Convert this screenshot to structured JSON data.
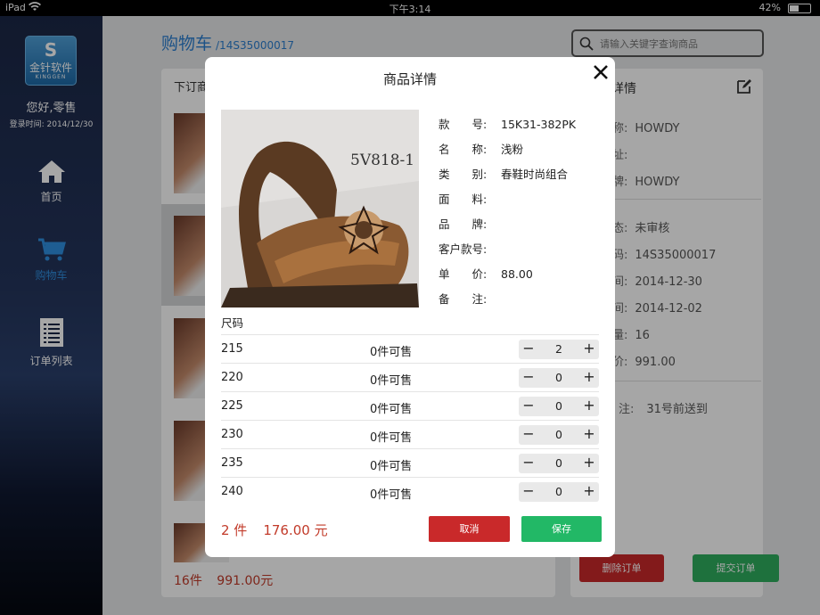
{
  "status_bar": {
    "device": "iPad",
    "time": "下午3:14",
    "battery": "42%"
  },
  "sidebar": {
    "logo": {
      "mark": "S",
      "cn": "金针软件",
      "en": "KINGGEN"
    },
    "greeting": "您好,零售",
    "login_time": "登录时间: 2014/12/30",
    "items": [
      {
        "label": "首页",
        "icon": "home-icon"
      },
      {
        "label": "购物车",
        "icon": "cart-icon",
        "active": true
      },
      {
        "label": "订单列表",
        "icon": "list-icon"
      }
    ]
  },
  "page": {
    "title": "购物车",
    "order_no": "/14S35000017",
    "search_placeholder": "请输入关键字查询商品",
    "left_header": "下订商",
    "left_summary": {
      "count": "16件",
      "total": "991.00元"
    },
    "right_header": "详情",
    "right_rows": [
      {
        "label": "名称:",
        "value": "HOWDY"
      },
      {
        "label": "地址:",
        "value": ""
      },
      {
        "label": "品牌:",
        "value": "HOWDY"
      },
      {
        "label": "状态:",
        "value": "未审核"
      },
      {
        "label": "号码:",
        "value": "14S35000017"
      },
      {
        "label": "时间:",
        "value": "2014-12-30"
      },
      {
        "label": "时间:",
        "value": "2014-12-02"
      },
      {
        "label": "数量:",
        "value": "16"
      },
      {
        "label": "总价:",
        "value": "991.00"
      },
      {
        "label": "注:",
        "value": "31号前送到"
      }
    ],
    "delete_label": "删除订单",
    "submit_label": "提交订单"
  },
  "modal": {
    "title": "商品详情",
    "image_caption": "5V818-1",
    "fields": [
      {
        "label": "款　　号:",
        "value": "15K31-382PK"
      },
      {
        "label": "名　　称:",
        "value": "浅粉"
      },
      {
        "label": "类　　别:",
        "value": "春鞋时尚组合"
      },
      {
        "label": "面　　料:",
        "value": ""
      },
      {
        "label": "品　　牌:",
        "value": ""
      },
      {
        "label": "客户款号:",
        "value": ""
      },
      {
        "label": "单　　价:",
        "value": "88.00"
      },
      {
        "label": "备　　注:",
        "value": ""
      }
    ],
    "size_header": "尺码",
    "sizes": [
      {
        "size": "215",
        "avail": "0件可售",
        "qty": "2"
      },
      {
        "size": "220",
        "avail": "0件可售",
        "qty": "0"
      },
      {
        "size": "225",
        "avail": "0件可售",
        "qty": "0"
      },
      {
        "size": "230",
        "avail": "0件可售",
        "qty": "0"
      },
      {
        "size": "235",
        "avail": "0件可售",
        "qty": "0"
      },
      {
        "size": "240",
        "avail": "0件可售",
        "qty": "0"
      }
    ],
    "stepper": {
      "minus": "−",
      "plus": "+"
    },
    "total_count": "2 件",
    "total_money": "176.00 元",
    "cancel_label": "取消",
    "save_label": "保存"
  },
  "colors": {
    "accent_blue": "#2c7fd0",
    "danger_red": "#c9292a",
    "success_green": "#22b866",
    "price_red": "#c23b2a"
  }
}
